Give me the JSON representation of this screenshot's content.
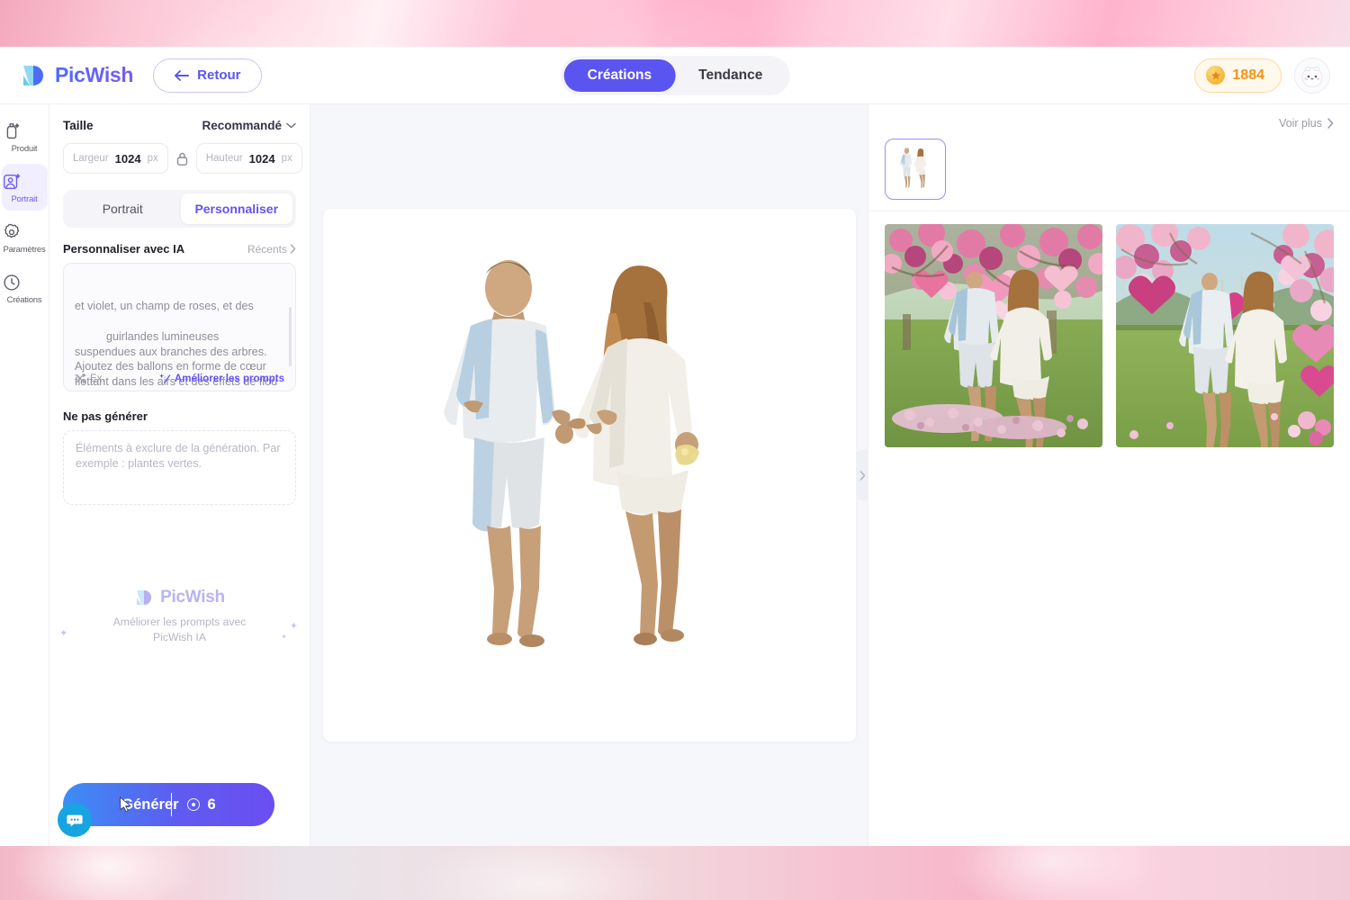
{
  "header": {
    "brand_name": "PicWish",
    "brand_logo_icon": "picwish-logo-icon",
    "back_label": "Retour",
    "back_icon": "arrow-left-icon",
    "tabs": [
      {
        "label": "Créations",
        "active": true
      },
      {
        "label": "Tendance",
        "active": false
      }
    ],
    "credits": {
      "icon": "star-icon",
      "value": "1884"
    },
    "avatar_icon": "user-avatar-cat-icon"
  },
  "rail": {
    "items": [
      {
        "label": "Produit",
        "icon": "bottle-sparkle-icon",
        "active": false
      },
      {
        "label": "Portrait",
        "icon": "portrait-sparkle-icon",
        "active": true
      },
      {
        "label": "Paramètres",
        "icon": "gear-icon",
        "active": false
      },
      {
        "label": "Créations",
        "icon": "clock-icon",
        "active": false
      }
    ]
  },
  "panel": {
    "size": {
      "title": "Taille",
      "preset_label": "Recommandé",
      "preset_caret_icon": "chevron-down-icon",
      "width_label": "Largeur",
      "width_value": "1024",
      "width_unit": "px",
      "lock_icon": "lock-icon",
      "height_label": "Hauteur",
      "height_value": "1024",
      "height_unit": "px"
    },
    "tabs": [
      {
        "label": "Portrait",
        "active": false
      },
      {
        "label": "Personnaliser",
        "active": true
      }
    ],
    "prompt": {
      "section_title": "Personnaliser avec IA",
      "recents_label": "Récents",
      "recents_caret_icon": "chevron-right-icon",
      "clipped_line": "et violet, un champ de roses, et des",
      "value": "guirlandes lumineuses suspendues aux branches des arbres. Ajoutez des ballons en forme de cœur flottant dans les airs et des effets de flou lumineux pour une ambiance douce et romantique.",
      "example_label": "Ex.",
      "example_icon": "shuffle-icon",
      "improve_label": "Améliorer les prompts",
      "improve_icon": "magic-wand-icon"
    },
    "negative": {
      "title": "Ne pas générer",
      "placeholder": "Éléments à exclure de la génération. Par exemple : plantes vertes."
    },
    "promo": {
      "logo_icon": "picwish-logo-icon",
      "brand": "PicWish",
      "line1": "Améliorer les prompts avec",
      "line2": "PicWish IA"
    },
    "generate": {
      "label": "Générer",
      "cost": "6",
      "coin_icon": "coin-icon",
      "cursor_icon": "mouse-pointer-icon"
    },
    "chat_fab_icon": "chat-bubble-icon"
  },
  "canvas": {
    "image_alt": "couple-walking-cutout",
    "collapse_icon": "chevron-right-icon"
  },
  "right": {
    "voir_plus_label": "Voir plus",
    "voir_plus_icon": "chevron-right-icon",
    "thumbnails": [
      {
        "name": "source-thumbnail-couple",
        "selected": true
      }
    ],
    "results": [
      {
        "name": "generated-result-1-heart-tree"
      },
      {
        "name": "generated-result-2-heart-balloons"
      }
    ]
  },
  "colors": {
    "accent": "#5a55f0",
    "accent_soft": "#6453f5",
    "credits": "#f59215",
    "chat": "#16a5e0",
    "canvas_bg": "#f6f7fb"
  }
}
